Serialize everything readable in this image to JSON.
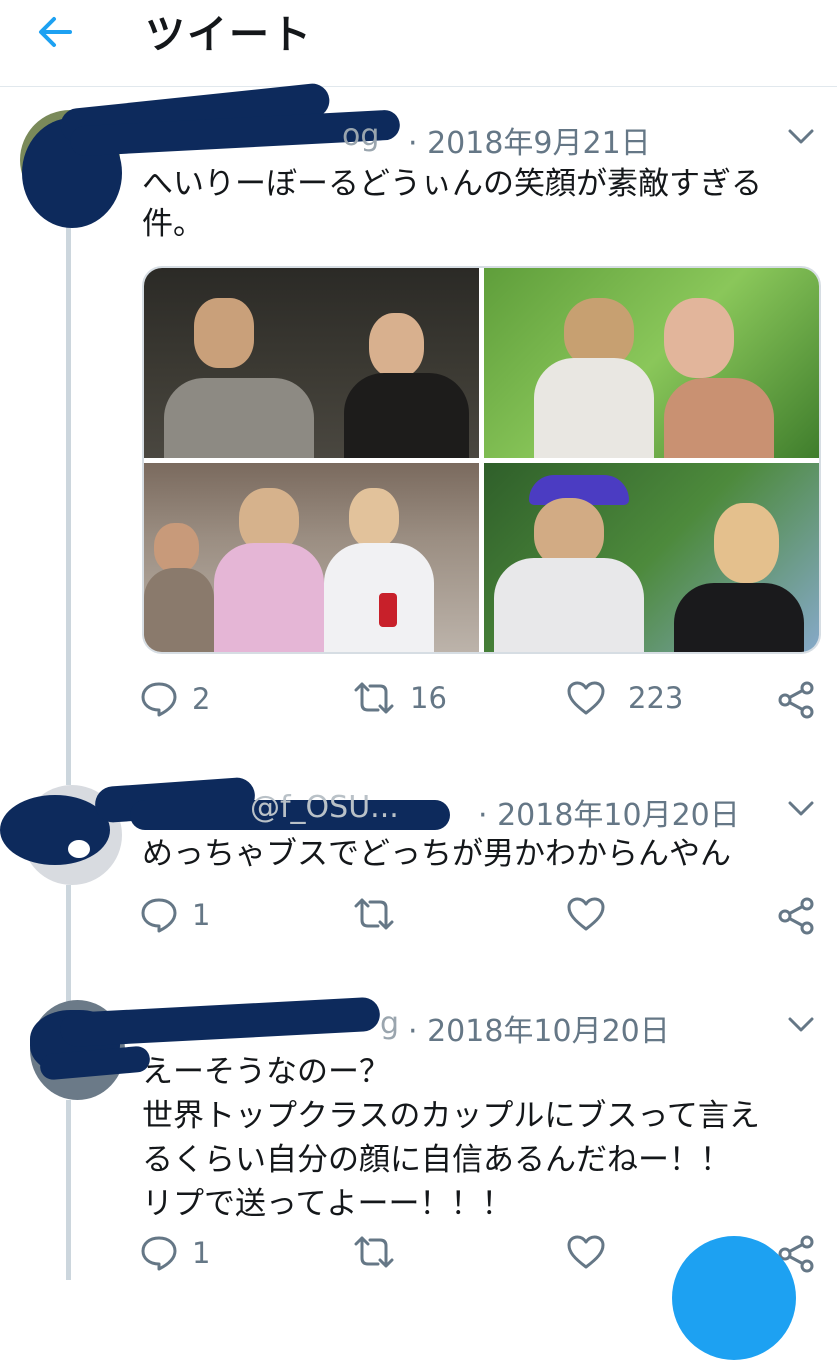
{
  "header": {
    "title": "ツイート",
    "back_icon": "arrow-left-icon",
    "accent": "#1da1f2"
  },
  "colors": {
    "redaction": "#0d2a5c",
    "meta": "#657786",
    "line": "#ccd6dd"
  },
  "tweets": [
    {
      "handle_fragment": "og",
      "meta": "· 2018年9月21日",
      "lines": [
        "へいりーぼーるどうぃんの笑顔が素敵すぎる",
        "件。"
      ],
      "media_count": 4,
      "reply_count": "2",
      "retweet_count": "16",
      "like_count": "223"
    },
    {
      "handle_fragment": "@f_OSU...",
      "meta": "· 2018年10月20日",
      "lines": [
        "めっちゃブスでどっちが男かわからんやん"
      ],
      "reply_count": "1",
      "retweet_count": "",
      "like_count": ""
    },
    {
      "handle_fragment": "g",
      "meta": "· 2018年10月20日",
      "lines": [
        "えーそうなのー？",
        "世界トップクラスのカップルにブスって言え",
        "るくらい自分の顔に自信あるんだねー！！",
        "リプで送ってよーー！！！"
      ],
      "reply_count": "1",
      "retweet_count": "",
      "like_count": ""
    }
  ]
}
